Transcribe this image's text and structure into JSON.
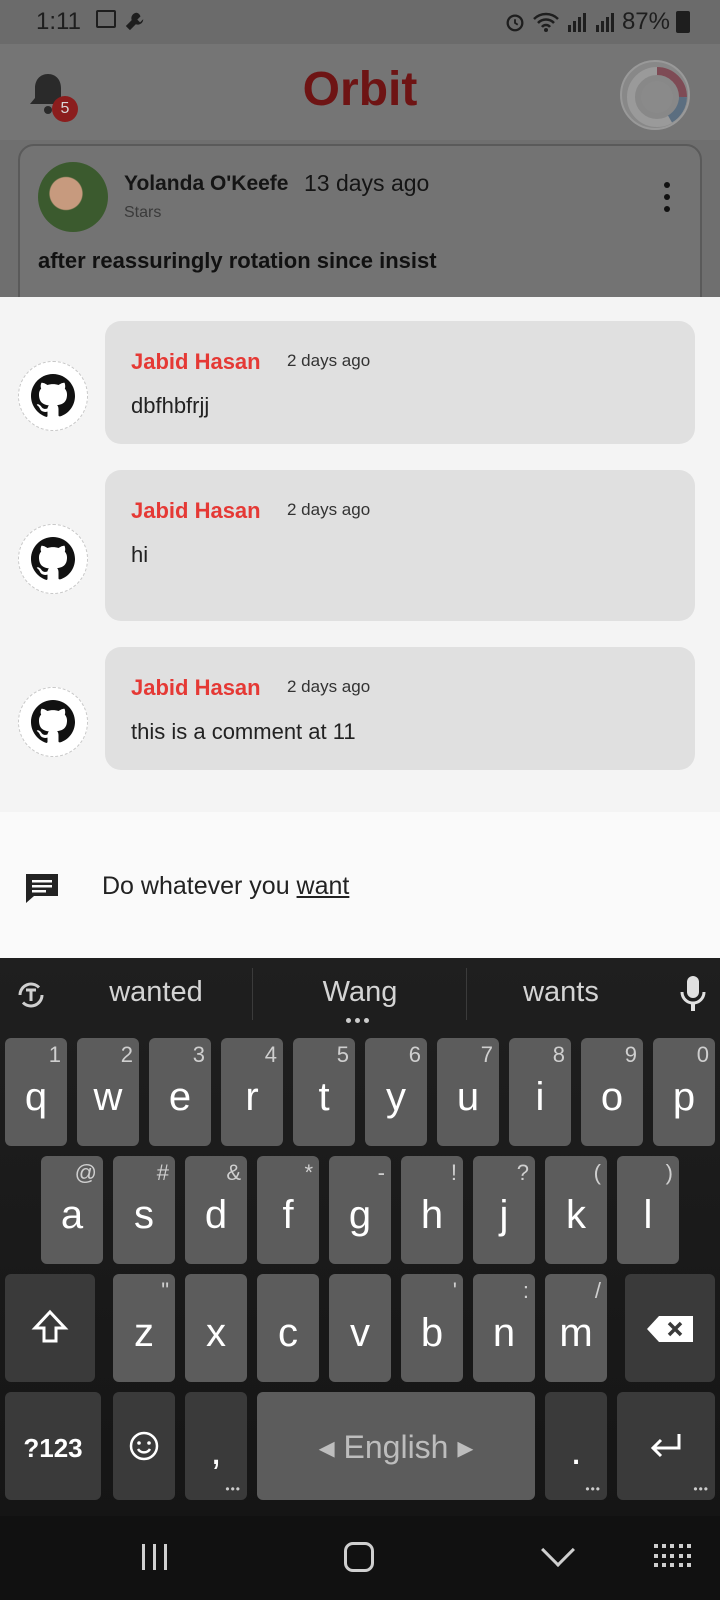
{
  "status_bar": {
    "time": "1:11",
    "battery": "87%"
  },
  "app_bar": {
    "title": "Orbit",
    "notification_count": "5"
  },
  "post": {
    "author": "Yolanda O'Keefe",
    "time": "13 days ago",
    "subtitle": "Stars",
    "title": "after reassuringly rotation since insist"
  },
  "comments": [
    {
      "author": "Jabid Hasan",
      "time": "2 days ago",
      "text": "dbfhbfrjj"
    },
    {
      "author": "Jabid Hasan",
      "time": "2 days ago",
      "text": "hi"
    },
    {
      "author": "Jabid Hasan",
      "time": "2 days ago",
      "text": "this is a comment at 11"
    }
  ],
  "comment_input": {
    "value_prefix": "Do whatever you ",
    "value_underlined": "want"
  },
  "keyboard": {
    "suggestions": [
      "wanted",
      "Wang",
      "wants"
    ],
    "row1": [
      {
        "k": "q",
        "h": "1"
      },
      {
        "k": "w",
        "h": "2"
      },
      {
        "k": "e",
        "h": "3"
      },
      {
        "k": "r",
        "h": "4"
      },
      {
        "k": "t",
        "h": "5"
      },
      {
        "k": "y",
        "h": "6"
      },
      {
        "k": "u",
        "h": "7"
      },
      {
        "k": "i",
        "h": "8"
      },
      {
        "k": "o",
        "h": "9"
      },
      {
        "k": "p",
        "h": "0"
      }
    ],
    "row2": [
      {
        "k": "a",
        "h": "@"
      },
      {
        "k": "s",
        "h": "#"
      },
      {
        "k": "d",
        "h": "&"
      },
      {
        "k": "f",
        "h": "*"
      },
      {
        "k": "g",
        "h": "-"
      },
      {
        "k": "h",
        "h": "!"
      },
      {
        "k": "j",
        "h": "?"
      },
      {
        "k": "k",
        "h": "("
      },
      {
        "k": "l",
        "h": ")"
      }
    ],
    "row3": [
      {
        "k": "z",
        "h": "\""
      },
      {
        "k": "x",
        "h": ""
      },
      {
        "k": "c",
        "h": ""
      },
      {
        "k": "v",
        "h": ""
      },
      {
        "k": "b",
        "h": "'"
      },
      {
        "k": "n",
        "h": ":"
      },
      {
        "k": "m",
        "h": "/"
      }
    ],
    "symbols_label": "?123",
    "comma": ",",
    "period": ".",
    "space_label": "English"
  }
}
